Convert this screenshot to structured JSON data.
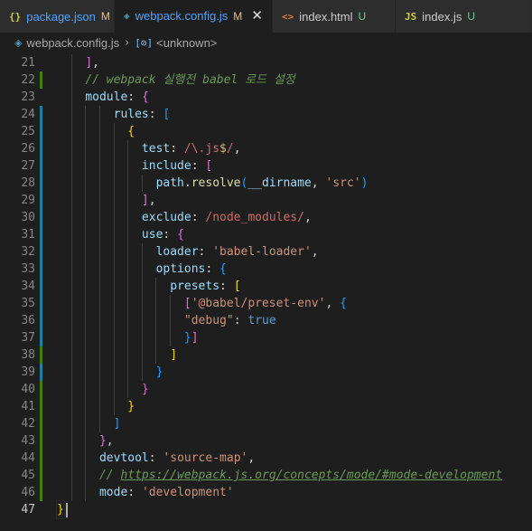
{
  "tabs": [
    {
      "icon": "{}",
      "icon_color": "#cbcb41",
      "name": "package.json",
      "status": "M",
      "status_color": "#e2c08d",
      "name_color": "#4fa3ff",
      "active": false,
      "width": 127
    },
    {
      "icon": "◈",
      "icon_color": "#519aba",
      "name": "webpack.config.js",
      "status": "M",
      "status_color": "#e2c08d",
      "name_color": "#4fa3ff",
      "active": true,
      "width": 175,
      "close": "✕"
    },
    {
      "icon": "<>",
      "icon_color": "#e37933",
      "name": "index.html",
      "status": "U",
      "status_color": "#73c991",
      "name_color": "#cccccc",
      "active": false,
      "width": 136
    },
    {
      "icon": "JS",
      "icon_color": "#cbcb41",
      "name": "index.js",
      "status": "U",
      "status_color": "#73c991",
      "name_color": "#cccccc",
      "active": false,
      "width": 151
    }
  ],
  "breadcrumb": {
    "file": "webpack.config.js",
    "symbol_icon": "[⊘]",
    "symbol": "<unknown>"
  },
  "editor": {
    "lines": [
      {
        "num": "21",
        "gutter": "none",
        "tokens": [
          [
            "punct",
            "    "
          ],
          [
            "bracket2",
            "]"
          ],
          [
            "punct",
            ","
          ]
        ]
      },
      {
        "num": "22",
        "gutter": "add",
        "tokens": [
          [
            "punct",
            "    "
          ],
          [
            "comment",
            "// webpack 실행전 babel 로드 설정"
          ]
        ]
      },
      {
        "num": "23",
        "gutter": "none",
        "tokens": [
          [
            "punct",
            "    "
          ],
          [
            "prop",
            "module"
          ],
          [
            "punct",
            ": "
          ],
          [
            "bracket2",
            "{"
          ]
        ]
      },
      {
        "num": "24",
        "gutter": "mod",
        "tokens": [
          [
            "punct",
            "        "
          ],
          [
            "prop",
            "rules"
          ],
          [
            "punct",
            ": "
          ],
          [
            "bracket3",
            "["
          ]
        ]
      },
      {
        "num": "25",
        "gutter": "mod",
        "tokens": [
          [
            "punct",
            "          "
          ],
          [
            "bracket1",
            "{"
          ]
        ]
      },
      {
        "num": "26",
        "gutter": "mod",
        "tokens": [
          [
            "punct",
            "            "
          ],
          [
            "prop",
            "test"
          ],
          [
            "punct",
            ": "
          ],
          [
            "regex",
            "/\\.js"
          ],
          [
            "regexop",
            "$"
          ],
          [
            "regex",
            "/"
          ],
          [
            "punct",
            ","
          ]
        ]
      },
      {
        "num": "27",
        "gutter": "mod",
        "tokens": [
          [
            "punct",
            "            "
          ],
          [
            "prop",
            "include"
          ],
          [
            "punct",
            ": "
          ],
          [
            "bracket2",
            "["
          ]
        ]
      },
      {
        "num": "28",
        "gutter": "mod",
        "tokens": [
          [
            "punct",
            "              "
          ],
          [
            "var",
            "path"
          ],
          [
            "punct",
            "."
          ],
          [
            "fn",
            "resolve"
          ],
          [
            "bracket3",
            "("
          ],
          [
            "var",
            "__dirname"
          ],
          [
            "punct",
            ", "
          ],
          [
            "string",
            "'src'"
          ],
          [
            "bracket3",
            ")"
          ]
        ]
      },
      {
        "num": "29",
        "gutter": "mod",
        "tokens": [
          [
            "punct",
            "            "
          ],
          [
            "bracket2",
            "]"
          ],
          [
            "punct",
            ","
          ]
        ]
      },
      {
        "num": "30",
        "gutter": "mod",
        "tokens": [
          [
            "punct",
            "            "
          ],
          [
            "prop",
            "exclude"
          ],
          [
            "punct",
            ": "
          ],
          [
            "regex",
            "/node_modules/"
          ],
          [
            "punct",
            ","
          ]
        ]
      },
      {
        "num": "31",
        "gutter": "mod",
        "tokens": [
          [
            "punct",
            "            "
          ],
          [
            "prop",
            "use"
          ],
          [
            "punct",
            ": "
          ],
          [
            "bracket2",
            "{"
          ]
        ]
      },
      {
        "num": "32",
        "gutter": "mod",
        "tokens": [
          [
            "punct",
            "              "
          ],
          [
            "prop",
            "loader"
          ],
          [
            "punct",
            ": "
          ],
          [
            "string",
            "'babel-loader'"
          ],
          [
            "punct",
            ","
          ]
        ]
      },
      {
        "num": "33",
        "gutter": "mod",
        "tokens": [
          [
            "punct",
            "              "
          ],
          [
            "prop",
            "options"
          ],
          [
            "punct",
            ": "
          ],
          [
            "bracket3",
            "{"
          ]
        ]
      },
      {
        "num": "34",
        "gutter": "mod",
        "tokens": [
          [
            "punct",
            "                "
          ],
          [
            "prop",
            "presets"
          ],
          [
            "punct",
            ": "
          ],
          [
            "bracket1",
            "["
          ]
        ]
      },
      {
        "num": "35",
        "gutter": "mod",
        "tokens": [
          [
            "punct",
            "                  "
          ],
          [
            "bracket2",
            "["
          ],
          [
            "string",
            "'@babel/preset-env'"
          ],
          [
            "punct",
            ", "
          ],
          [
            "bracket3",
            "{"
          ]
        ]
      },
      {
        "num": "36",
        "gutter": "mod",
        "tokens": [
          [
            "punct",
            "                  "
          ],
          [
            "string",
            "\"debug\""
          ],
          [
            "punct",
            ": "
          ],
          [
            "bool",
            "true"
          ]
        ]
      },
      {
        "num": "37",
        "gutter": "mod",
        "tokens": [
          [
            "punct",
            "                  "
          ],
          [
            "bracket3",
            "}"
          ],
          [
            "bracket2",
            "]"
          ]
        ]
      },
      {
        "num": "38",
        "gutter": "add",
        "tokens": [
          [
            "punct",
            "                "
          ],
          [
            "bracket1",
            "]"
          ]
        ]
      },
      {
        "num": "39",
        "gutter": "mod",
        "tokens": [
          [
            "punct",
            "              "
          ],
          [
            "bracket3",
            "}"
          ]
        ]
      },
      {
        "num": "40",
        "gutter": "add",
        "tokens": [
          [
            "punct",
            "            "
          ],
          [
            "bracket2",
            "}"
          ]
        ]
      },
      {
        "num": "41",
        "gutter": "add",
        "tokens": [
          [
            "punct",
            "          "
          ],
          [
            "bracket1",
            "}"
          ]
        ]
      },
      {
        "num": "42",
        "gutter": "add",
        "tokens": [
          [
            "punct",
            "        "
          ],
          [
            "bracket3",
            "]"
          ]
        ]
      },
      {
        "num": "43",
        "gutter": "add",
        "tokens": [
          [
            "punct",
            "      "
          ],
          [
            "bracket2",
            "}"
          ],
          [
            "punct",
            ","
          ]
        ]
      },
      {
        "num": "44",
        "gutter": "add",
        "tokens": [
          [
            "punct",
            "      "
          ],
          [
            "prop",
            "devtool"
          ],
          [
            "punct",
            ": "
          ],
          [
            "string",
            "'source-map'"
          ],
          [
            "punct",
            ","
          ]
        ]
      },
      {
        "num": "45",
        "gutter": "add",
        "tokens": [
          [
            "punct",
            "      "
          ],
          [
            "comment",
            "// "
          ],
          [
            "link",
            "https://webpack.js.org/concepts/mode/#mode-development"
          ]
        ]
      },
      {
        "num": "46",
        "gutter": "add",
        "tokens": [
          [
            "punct",
            "      "
          ],
          [
            "prop",
            "mode"
          ],
          [
            "punct",
            ": "
          ],
          [
            "string",
            "'development'"
          ]
        ]
      },
      {
        "num": "47",
        "gutter": "none",
        "current": true,
        "tokens": [
          [
            "bracket1",
            "}"
          ]
        ]
      }
    ]
  }
}
